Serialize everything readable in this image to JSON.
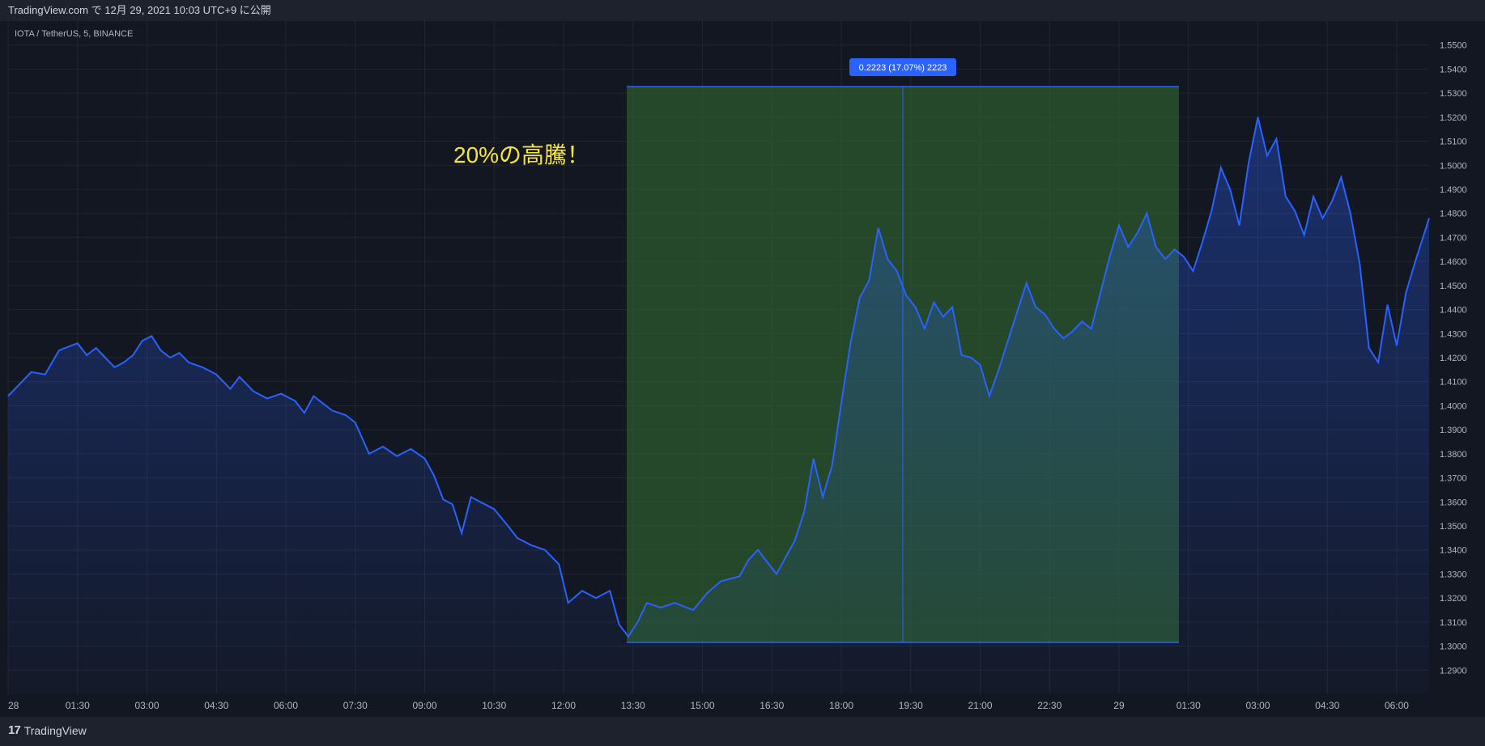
{
  "header": {
    "published": "TradingView.com で 12月 29, 2021 10:03 UTC+9 に公開"
  },
  "symbol_label": "IOTA / TetherUS, 5, BINANCE",
  "annotation_text": "20%の高騰！",
  "measure_label": "0.2223 (17.07%) 2223",
  "footer": {
    "brand": "TradingView",
    "logo_mark": "17"
  },
  "colors": {
    "background": "#131722",
    "line": "#2962ff",
    "text": "#b2b5be",
    "annotation": "#f5e63a",
    "measure_fill": "#2e5e2e",
    "badge": "#2962ff"
  },
  "chart_data": {
    "type": "area",
    "title": "IOTA / TetherUS, 5, BINANCE",
    "xlabel": "",
    "ylabel": "",
    "ylim": [
      1.28,
      1.56
    ],
    "x_ticks": [
      "28",
      "01:30",
      "03:00",
      "04:30",
      "06:00",
      "07:30",
      "09:00",
      "10:30",
      "12:00",
      "13:30",
      "15:00",
      "16:30",
      "18:00",
      "19:30",
      "21:00",
      "22:30",
      "29",
      "01:30",
      "03:00",
      "04:30",
      "06:00"
    ],
    "y_ticks": [
      "1.5500",
      "1.5400",
      "1.5300",
      "1.5200",
      "1.5100",
      "1.5000",
      "1.4900",
      "1.4800",
      "1.4700",
      "1.4600",
      "1.4500",
      "1.4400",
      "1.4300",
      "1.4200",
      "1.4100",
      "1.4000",
      "1.3900",
      "1.3800",
      "1.3700",
      "1.3600",
      "1.3500",
      "1.3400",
      "1.3300",
      "1.3200",
      "1.3100",
      "1.3000",
      "1.2900"
    ],
    "x_span_hours": [
      0,
      30.7
    ],
    "series": [
      {
        "values": [
          [
            0.0,
            1.404
          ],
          [
            0.5,
            1.414
          ],
          [
            0.8,
            1.413
          ],
          [
            1.1,
            1.423
          ],
          [
            1.5,
            1.426
          ],
          [
            1.7,
            1.421
          ],
          [
            1.9,
            1.424
          ],
          [
            2.1,
            1.42
          ],
          [
            2.3,
            1.416
          ],
          [
            2.5,
            1.418
          ],
          [
            2.7,
            1.421
          ],
          [
            2.9,
            1.427
          ],
          [
            3.1,
            1.429
          ],
          [
            3.3,
            1.423
          ],
          [
            3.5,
            1.42
          ],
          [
            3.7,
            1.422
          ],
          [
            3.9,
            1.418
          ],
          [
            4.2,
            1.416
          ],
          [
            4.5,
            1.413
          ],
          [
            4.8,
            1.407
          ],
          [
            5.0,
            1.412
          ],
          [
            5.3,
            1.406
          ],
          [
            5.6,
            1.403
          ],
          [
            5.9,
            1.405
          ],
          [
            6.2,
            1.402
          ],
          [
            6.4,
            1.397
          ],
          [
            6.6,
            1.404
          ],
          [
            6.8,
            1.401
          ],
          [
            7.0,
            1.398
          ],
          [
            7.3,
            1.396
          ],
          [
            7.5,
            1.393
          ],
          [
            7.8,
            1.38
          ],
          [
            8.1,
            1.383
          ],
          [
            8.4,
            1.379
          ],
          [
            8.7,
            1.382
          ],
          [
            9.0,
            1.378
          ],
          [
            9.2,
            1.371
          ],
          [
            9.4,
            1.361
          ],
          [
            9.6,
            1.359
          ],
          [
            9.8,
            1.347
          ],
          [
            10.0,
            1.362
          ],
          [
            10.3,
            1.359
          ],
          [
            10.5,
            1.357
          ],
          [
            10.8,
            1.35
          ],
          [
            11.0,
            1.345
          ],
          [
            11.3,
            1.342
          ],
          [
            11.6,
            1.34
          ],
          [
            11.9,
            1.334
          ],
          [
            12.1,
            1.318
          ],
          [
            12.4,
            1.323
          ],
          [
            12.7,
            1.32
          ],
          [
            13.0,
            1.323
          ],
          [
            13.2,
            1.309
          ],
          [
            13.4,
            1.304
          ],
          [
            13.6,
            1.31
          ],
          [
            13.8,
            1.318
          ],
          [
            14.1,
            1.316
          ],
          [
            14.4,
            1.318
          ],
          [
            14.8,
            1.315
          ],
          [
            15.1,
            1.322
          ],
          [
            15.4,
            1.327
          ],
          [
            15.8,
            1.329
          ],
          [
            16.0,
            1.336
          ],
          [
            16.2,
            1.34
          ],
          [
            16.4,
            1.335
          ],
          [
            16.6,
            1.33
          ],
          [
            16.8,
            1.337
          ],
          [
            17.0,
            1.344
          ],
          [
            17.2,
            1.356
          ],
          [
            17.4,
            1.378
          ],
          [
            17.6,
            1.362
          ],
          [
            17.8,
            1.375
          ],
          [
            18.0,
            1.401
          ],
          [
            18.2,
            1.426
          ],
          [
            18.4,
            1.445
          ],
          [
            18.6,
            1.452
          ],
          [
            18.8,
            1.474
          ],
          [
            19.0,
            1.461
          ],
          [
            19.2,
            1.456
          ],
          [
            19.4,
            1.446
          ],
          [
            19.6,
            1.441
          ],
          [
            19.8,
            1.432
          ],
          [
            20.0,
            1.443
          ],
          [
            20.2,
            1.437
          ],
          [
            20.4,
            1.441
          ],
          [
            20.6,
            1.421
          ],
          [
            20.8,
            1.42
          ],
          [
            21.0,
            1.417
          ],
          [
            21.2,
            1.404
          ],
          [
            21.4,
            1.415
          ],
          [
            21.6,
            1.427
          ],
          [
            21.8,
            1.439
          ],
          [
            22.0,
            1.451
          ],
          [
            22.2,
            1.441
          ],
          [
            22.4,
            1.438
          ],
          [
            22.6,
            1.432
          ],
          [
            22.8,
            1.428
          ],
          [
            23.0,
            1.431
          ],
          [
            23.2,
            1.435
          ],
          [
            23.4,
            1.432
          ],
          [
            23.6,
            1.447
          ],
          [
            23.8,
            1.462
          ],
          [
            24.0,
            1.475
          ],
          [
            24.2,
            1.466
          ],
          [
            24.4,
            1.472
          ],
          [
            24.6,
            1.48
          ],
          [
            24.8,
            1.466
          ],
          [
            25.0,
            1.461
          ],
          [
            25.2,
            1.465
          ],
          [
            25.4,
            1.462
          ],
          [
            25.6,
            1.456
          ],
          [
            25.8,
            1.468
          ],
          [
            26.0,
            1.481
          ],
          [
            26.2,
            1.499
          ],
          [
            26.4,
            1.49
          ],
          [
            26.6,
            1.475
          ],
          [
            26.8,
            1.501
          ],
          [
            27.0,
            1.52
          ],
          [
            27.2,
            1.504
          ],
          [
            27.4,
            1.511
          ],
          [
            27.6,
            1.487
          ],
          [
            27.8,
            1.481
          ],
          [
            28.0,
            1.471
          ],
          [
            28.2,
            1.487
          ],
          [
            28.4,
            1.478
          ],
          [
            28.6,
            1.485
          ],
          [
            28.8,
            1.495
          ],
          [
            29.0,
            1.48
          ],
          [
            29.2,
            1.459
          ],
          [
            29.4,
            1.424
          ],
          [
            29.6,
            1.418
          ],
          [
            29.8,
            1.442
          ],
          [
            30.0,
            1.425
          ],
          [
            30.2,
            1.447
          ],
          [
            30.4,
            1.46
          ],
          [
            30.6,
            1.472
          ],
          [
            30.7,
            1.478
          ]
        ]
      }
    ]
  }
}
